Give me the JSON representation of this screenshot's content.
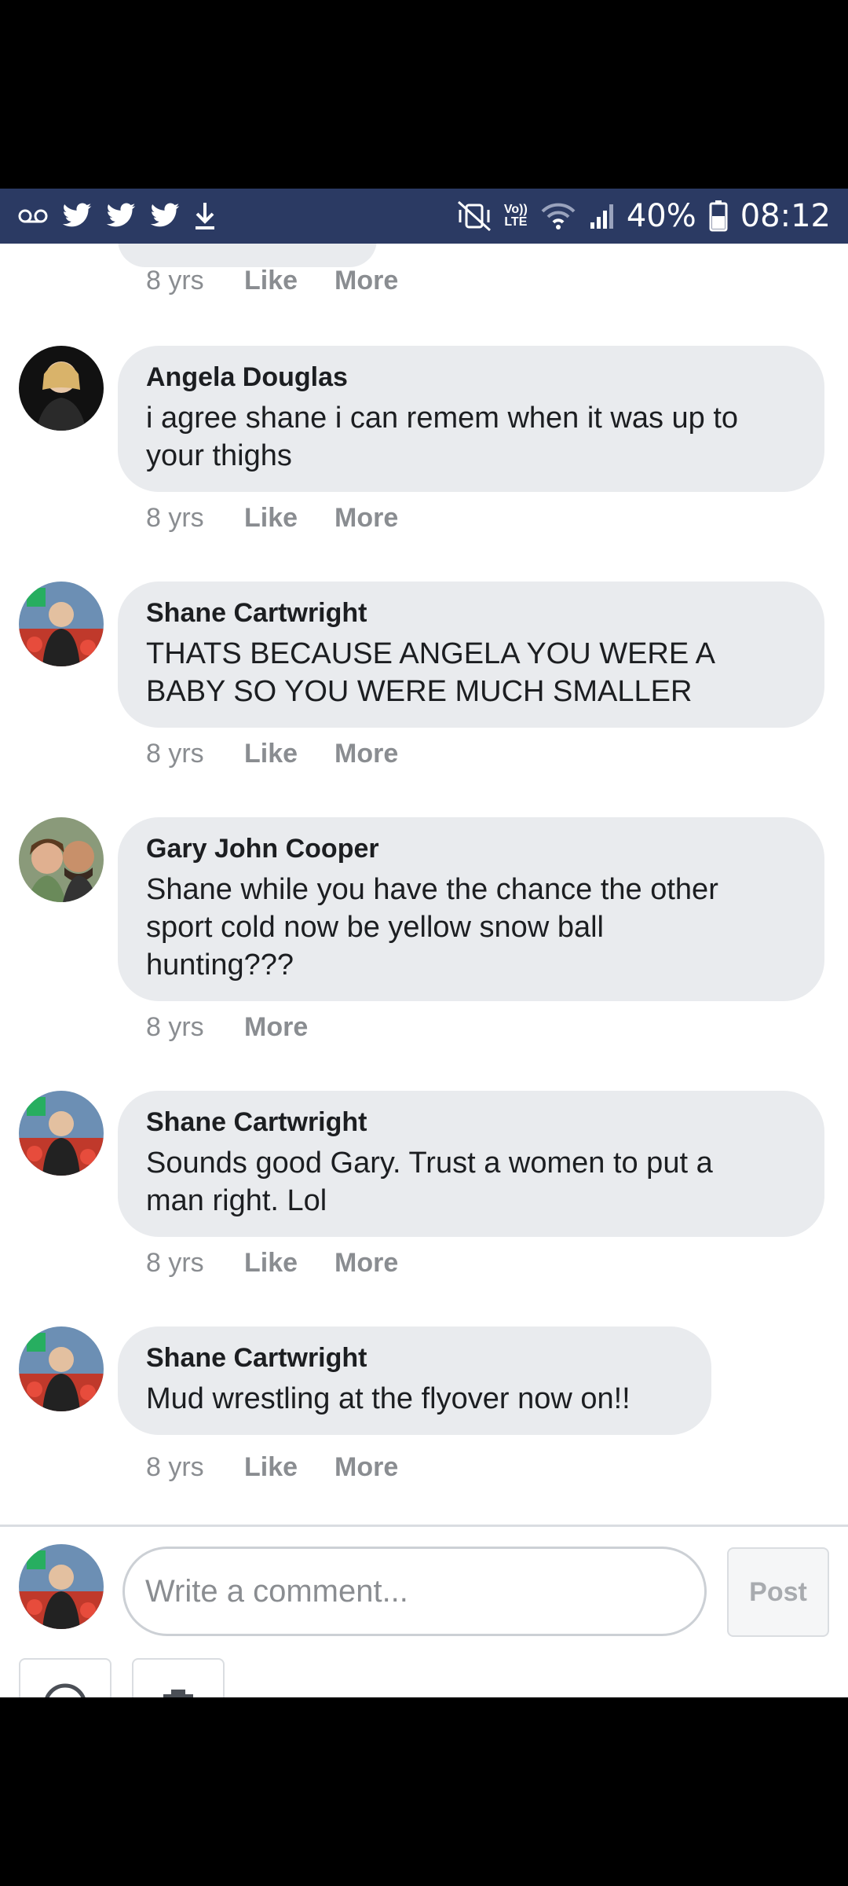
{
  "status_bar": {
    "battery_percent": "40%",
    "time": "08:12",
    "network": "LTE",
    "volte": "Vo))",
    "left_icons": [
      "voicemail-icon",
      "twitter-icon",
      "twitter-icon",
      "twitter-icon",
      "download-icon"
    ],
    "right_icons": [
      "mute-vibrate-icon",
      "volte-icon",
      "wifi-icon",
      "signal-icon",
      "battery-icon"
    ]
  },
  "previous_comment_meta": {
    "time": "8 yrs",
    "like": "Like",
    "more": "More"
  },
  "comments": [
    {
      "name": "Angela Douglas",
      "text_lines": [
        "i agree shane i can remem when it was up to",
        "your thighs"
      ],
      "time": "8 yrs",
      "like": "Like",
      "more": "More"
    },
    {
      "name": "Shane Cartwright",
      "text_lines": [
        "THATS BECAUSE ANGELA YOU WERE A",
        "BABY SO YOU WERE MUCH SMALLER"
      ],
      "time": "8 yrs",
      "like": "Like",
      "more": "More"
    },
    {
      "name": "Gary John Cooper",
      "text_lines": [
        "Shane while you have the chance the other",
        "sport cold now be yellow snow ball",
        "hunting???"
      ],
      "time": "8 yrs",
      "like": "",
      "more": "More"
    },
    {
      "name": "Shane Cartwright",
      "text_lines": [
        "Sounds good Gary. Trust a women to put a",
        "man right. Lol"
      ],
      "time": "8 yrs",
      "like": "Like",
      "more": "More"
    },
    {
      "name": "Shane Cartwright",
      "text_lines": [
        "Mud wrestling at the flyover now on!!"
      ],
      "time": "8 yrs",
      "like": "Like",
      "more": "More"
    }
  ],
  "composer": {
    "placeholder": "Write a comment...",
    "post_label": "Post"
  },
  "colors": {
    "status_bar": "#2b3a63",
    "bubble": "#e9ebee",
    "meta_text": "#8a8d91"
  }
}
